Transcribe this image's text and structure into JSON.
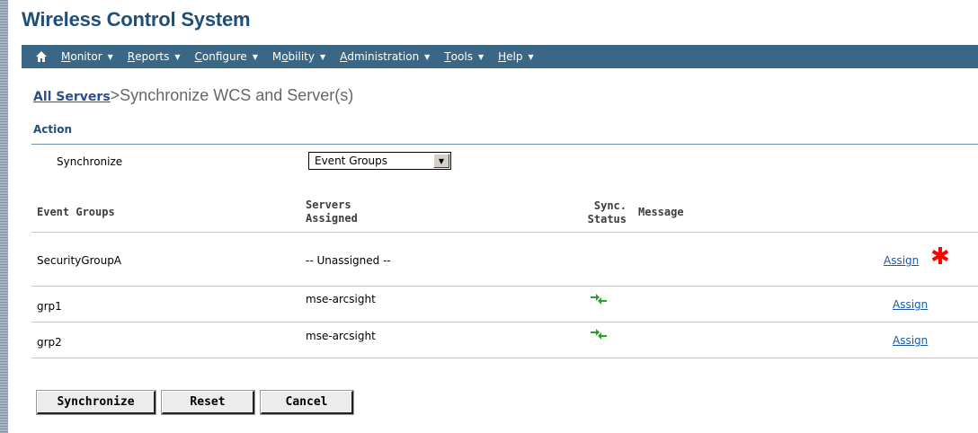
{
  "app": {
    "title": "Wireless Control System"
  },
  "menu": {
    "items": [
      {
        "pre": "",
        "key": "M",
        "post": "onitor"
      },
      {
        "pre": "",
        "key": "R",
        "post": "eports"
      },
      {
        "pre": "",
        "key": "C",
        "post": "onfigure"
      },
      {
        "pre": "M",
        "key": "o",
        "post": "bility"
      },
      {
        "pre": "",
        "key": "A",
        "post": "dministration"
      },
      {
        "pre": "",
        "key": "T",
        "post": "ools"
      },
      {
        "pre": "",
        "key": "H",
        "post": "elp"
      }
    ]
  },
  "breadcrumb": {
    "link": "All Servers",
    "separator": ">",
    "title": " Synchronize WCS and Server(s)"
  },
  "action": {
    "section_title": "Action",
    "sync_label": "Synchronize",
    "select_value": "Event Groups"
  },
  "table": {
    "headers": {
      "groups": "Event Groups",
      "servers_1": "Servers",
      "servers_2": "Assigned",
      "sync_1": "Sync.",
      "sync_2": "Status",
      "message": "Message"
    },
    "rows": [
      {
        "group": "SecurityGroupA",
        "servers": "-- Unassigned --",
        "status": "",
        "message": "",
        "assign": "Assign",
        "required": true
      },
      {
        "group": "grp1",
        "servers": "mse-arcsight",
        "status": "synchronized",
        "message": "",
        "assign": "Assign",
        "required": false
      },
      {
        "group": "grp2",
        "servers": "mse-arcsight",
        "status": "synchronized",
        "message": "",
        "assign": "Assign",
        "required": false
      }
    ]
  },
  "buttons": {
    "synchronize": "Synchronize",
    "reset": "Reset",
    "cancel": "Cancel"
  },
  "colors": {
    "menubar": "#3b6787",
    "title": "#1f4e7a",
    "link": "#1d5aa6",
    "sync_icon": "#2aa02a",
    "required_star": "#ff0000"
  },
  "icons": {
    "home": "home-icon",
    "sync": "sync-status-icon",
    "required": "required-star-icon"
  }
}
